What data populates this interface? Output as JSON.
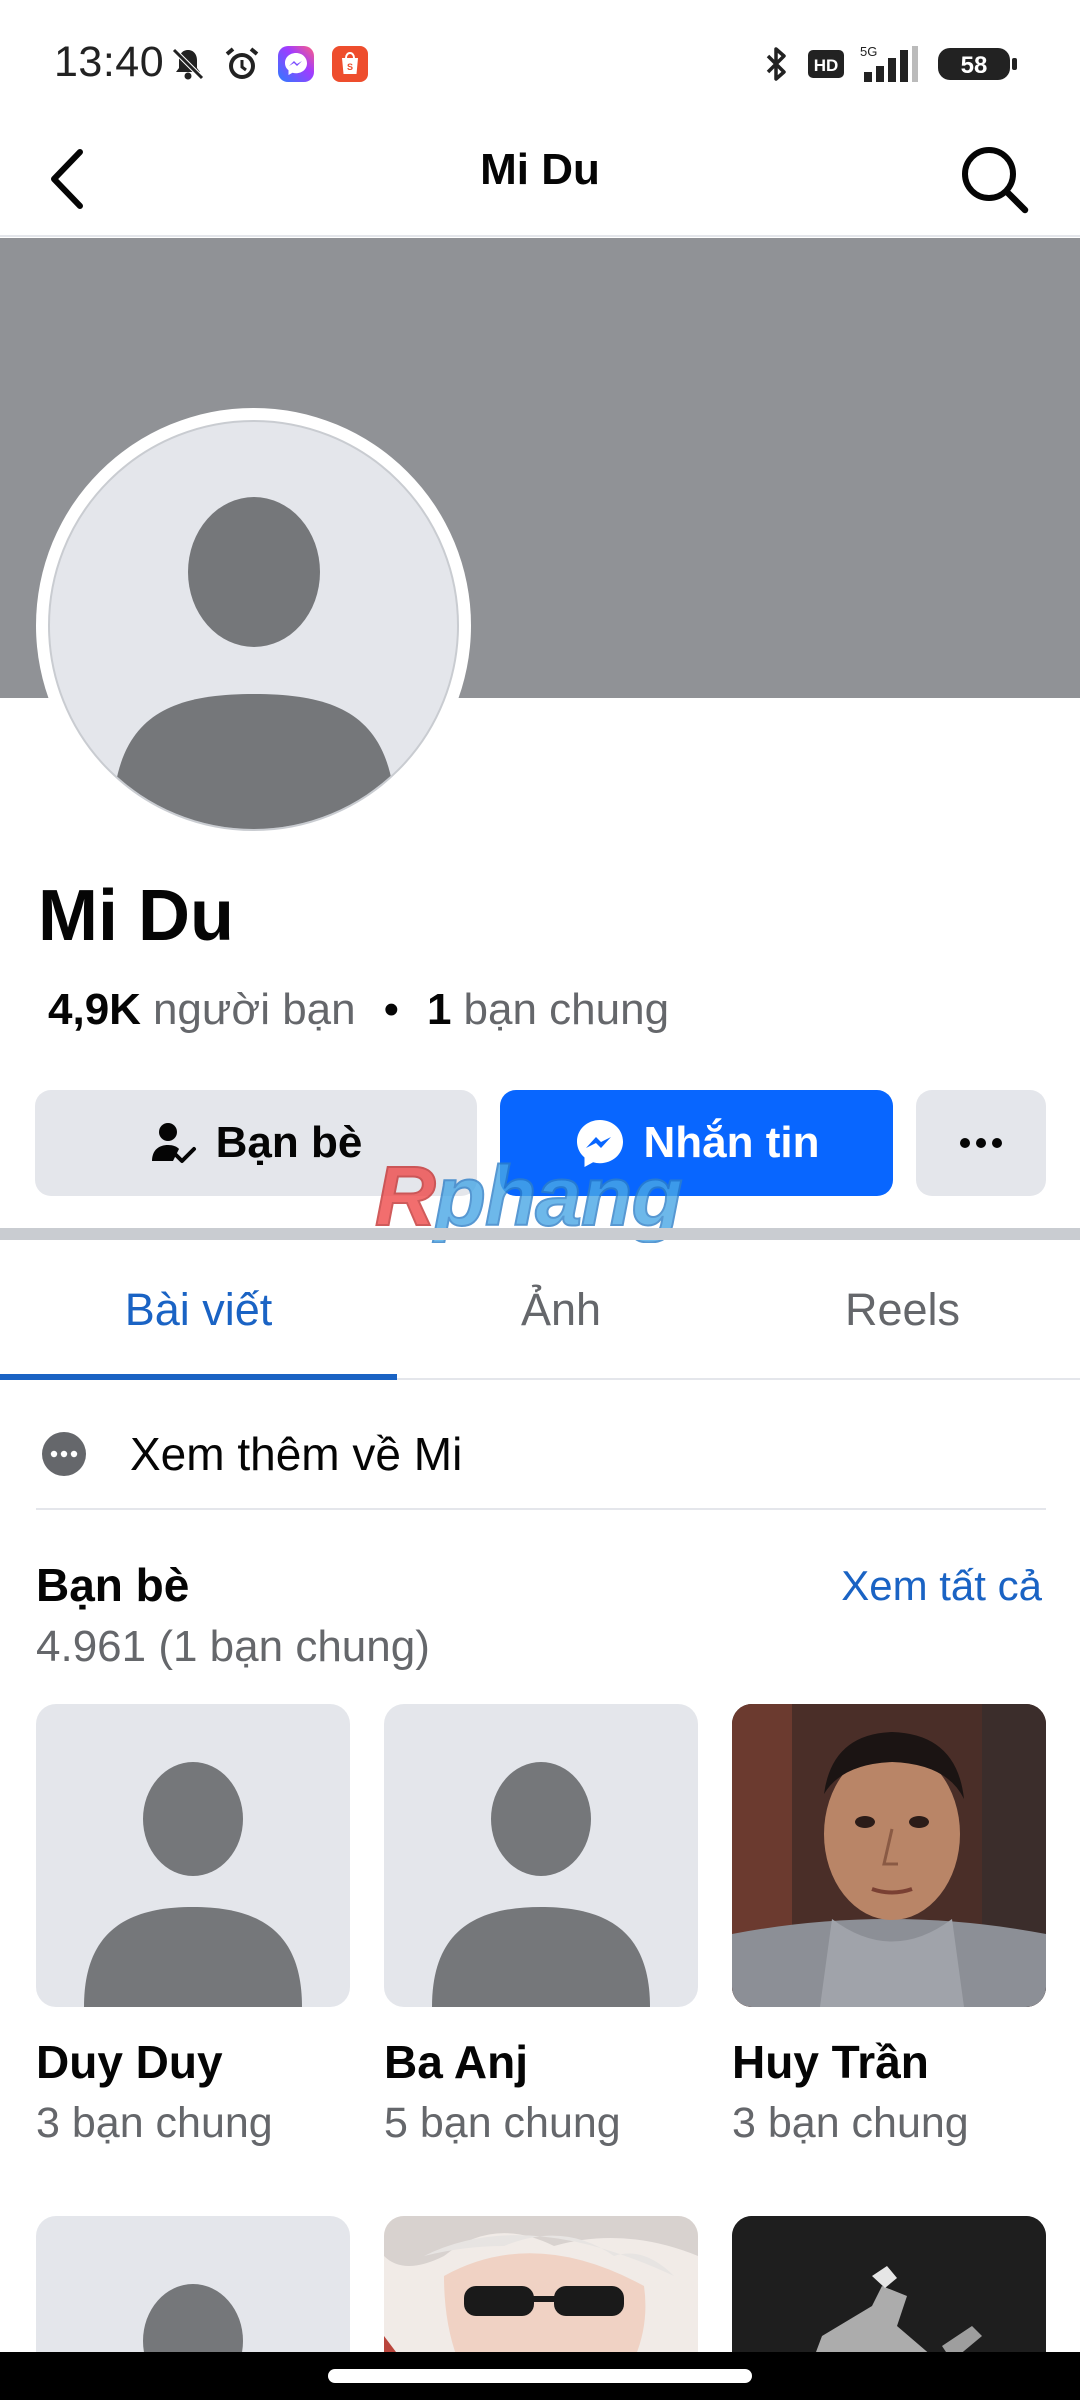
{
  "status_bar": {
    "time": "13:40",
    "battery": "58",
    "network": "5G",
    "hd_label": "HD",
    "icons": [
      "mute-icon",
      "alarm-icon",
      "messenger-icon",
      "shopee-icon",
      "bluetooth-icon",
      "hd-icon",
      "signal-icon",
      "battery-icon"
    ]
  },
  "nav": {
    "title": "Mi Du",
    "back_icon": "chevron-left-icon",
    "search_icon": "search-icon"
  },
  "profile": {
    "name": "Mi Du",
    "friend_count": "4,9K",
    "friend_label": "người bạn",
    "separator": "•",
    "mutual_count": "1",
    "mutual_label": "bạn chung"
  },
  "actions": {
    "friends_label": "Bạn bè",
    "message_label": "Nhắn tin",
    "more_label": "···"
  },
  "watermark": {
    "first_letter": "R",
    "rest": "phang"
  },
  "tabs": [
    {
      "label": "Bài viết",
      "active": true
    },
    {
      "label": "Ảnh",
      "active": false
    },
    {
      "label": "Reels",
      "active": false
    }
  ],
  "more_about": {
    "label": "Xem thêm về Mi"
  },
  "friends_section": {
    "title": "Bạn bè",
    "see_all": "Xem tất cả",
    "count_text": "4.961 (1 bạn chung)",
    "items": [
      {
        "name": "Duy Duy",
        "mutual": "3 bạn chung",
        "photo": "default-avatar"
      },
      {
        "name": "Ba Anj",
        "mutual": "5 bạn chung",
        "photo": "default-avatar"
      },
      {
        "name": "Huy Trần",
        "mutual": "3 bạn chung",
        "photo": "photo"
      }
    ]
  },
  "colors": {
    "accent": "#0866ff",
    "link": "#1a63c4",
    "cover": "#909296",
    "secondary_button": "#e4e6eb",
    "muted_text": "#65676b"
  }
}
